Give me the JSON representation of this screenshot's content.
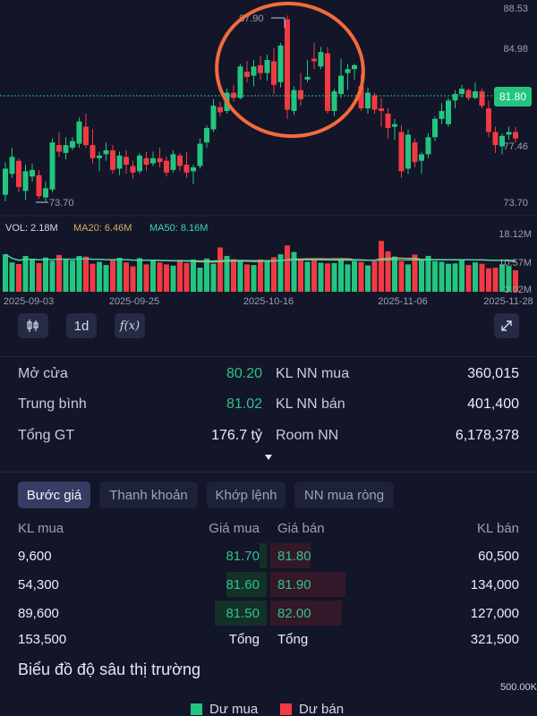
{
  "chart_data": {
    "type": "candlestick",
    "price_axis": {
      "ticks": [
        "88.53",
        "84.98",
        "77.46",
        "73.70"
      ],
      "current": "81.80",
      "high_label": "87.90",
      "low_label": "73.70"
    },
    "volume_axis": {
      "ticks": [
        "18.12M",
        "10.57M",
        "3.02M"
      ]
    },
    "x_labels": [
      "2025-09-03",
      "2025-09-25",
      "2025-10-16",
      "2025-11-06",
      "2025-11-28"
    ],
    "candles": [
      [
        74.2,
        76.7,
        73.7,
        76.2
      ],
      [
        75.8,
        77.8,
        75.5,
        77.1
      ],
      [
        76.8,
        77.0,
        74.4,
        74.8
      ],
      [
        74.5,
        76.5,
        73.8,
        76.0
      ],
      [
        75.6,
        76.6,
        75.2,
        76.1
      ],
      [
        75.7,
        76.1,
        73.9,
        74.1
      ],
      [
        74.0,
        75.2,
        73.7,
        74.7
      ],
      [
        74.6,
        78.5,
        74.4,
        78.2
      ],
      [
        78.0,
        79.0,
        77.1,
        77.5
      ],
      [
        77.4,
        78.6,
        76.9,
        78.0
      ],
      [
        77.8,
        78.6,
        77.6,
        78.3
      ],
      [
        78.1,
        80.1,
        77.8,
        79.8
      ],
      [
        79.4,
        80.4,
        77.8,
        78.0
      ],
      [
        78.0,
        79.2,
        76.6,
        77.0
      ],
      [
        77.0,
        77.5,
        76.0,
        77.2
      ],
      [
        77.3,
        78.2,
        76.8,
        77.6
      ],
      [
        77.6,
        78.0,
        75.8,
        76.1
      ],
      [
        76.2,
        77.5,
        75.7,
        77.2
      ],
      [
        77.1,
        77.6,
        75.8,
        76.5
      ],
      [
        76.4,
        76.8,
        75.4,
        75.9
      ],
      [
        76.0,
        77.4,
        75.8,
        77.2
      ],
      [
        77.0,
        77.5,
        76.0,
        76.5
      ],
      [
        76.6,
        77.5,
        76.4,
        77.0
      ],
      [
        77.0,
        77.8,
        76.3,
        76.7
      ],
      [
        76.8,
        77.1,
        75.6,
        75.9
      ],
      [
        76.1,
        77.6,
        75.9,
        77.3
      ],
      [
        77.2,
        77.4,
        76.0,
        76.4
      ],
      [
        76.5,
        77.5,
        75.5,
        75.9
      ],
      [
        76.0,
        76.5,
        75.0,
        76.3
      ],
      [
        76.4,
        78.5,
        76.2,
        78.1
      ],
      [
        78.2,
        79.5,
        77.8,
        79.3
      ],
      [
        79.2,
        81.5,
        79.0,
        81.0
      ],
      [
        80.9,
        81.3,
        80.2,
        80.5
      ],
      [
        80.6,
        82.3,
        80.4,
        82.0
      ],
      [
        82.0,
        82.6,
        81.3,
        81.6
      ],
      [
        81.6,
        84.2,
        81.5,
        84.0
      ],
      [
        83.6,
        84.4,
        82.8,
        83.2
      ],
      [
        83.3,
        84.5,
        82.5,
        84.0
      ],
      [
        84.1,
        84.8,
        83.0,
        83.5
      ],
      [
        83.5,
        84.9,
        82.9,
        84.5
      ],
      [
        84.4,
        85.4,
        81.9,
        82.6
      ],
      [
        82.8,
        85.8,
        82.4,
        85.6
      ],
      [
        87.6,
        87.9,
        80.0,
        80.7
      ],
      [
        80.6,
        82.5,
        80.3,
        82.2
      ],
      [
        82.2,
        83.5,
        81.0,
        81.5
      ],
      [
        83.0,
        84.5,
        82.8,
        83.2
      ],
      [
        84.6,
        85.8,
        83.8,
        84.4
      ],
      [
        84.0,
        85.5,
        83.8,
        85.1
      ],
      [
        85.0,
        85.5,
        80.4,
        80.6
      ],
      [
        80.6,
        82.3,
        80.2,
        82.1
      ],
      [
        81.9,
        84.6,
        81.6,
        83.3
      ],
      [
        83.5,
        84.2,
        82.2,
        83.8
      ],
      [
        83.8,
        84.2,
        83.0,
        84.1
      ],
      [
        82.5,
        83.4,
        80.6,
        80.8
      ],
      [
        80.8,
        82.4,
        80.4,
        82.0
      ],
      [
        81.8,
        82.0,
        80.4,
        80.7
      ],
      [
        80.8,
        81.6,
        79.4,
        80.6
      ],
      [
        80.4,
        80.8,
        78.5,
        79.3
      ],
      [
        79.4,
        80.0,
        78.4,
        79.6
      ],
      [
        79.0,
        79.5,
        75.5,
        76.0
      ],
      [
        76.2,
        79.2,
        75.8,
        78.8
      ],
      [
        78.2,
        78.5,
        76.3,
        76.7
      ],
      [
        76.8,
        77.5,
        75.8,
        77.3
      ],
      [
        77.3,
        78.9,
        77.0,
        78.6
      ],
      [
        78.6,
        80.2,
        78.3,
        80.0
      ],
      [
        80.0,
        81.2,
        79.6,
        80.6
      ],
      [
        79.6,
        81.6,
        79.4,
        81.4
      ],
      [
        81.4,
        82.2,
        80.8,
        81.9
      ],
      [
        81.9,
        82.6,
        81.6,
        82.3
      ],
      [
        82.2,
        82.3,
        81.4,
        81.6
      ],
      [
        81.6,
        82.8,
        81.5,
        82.1
      ],
      [
        82.1,
        82.3,
        80.8,
        81.0
      ],
      [
        80.8,
        81.4,
        78.6,
        79.0
      ],
      [
        79.0,
        79.4,
        77.4,
        78.0
      ],
      [
        77.9,
        78.9,
        77.3,
        78.7
      ],
      [
        78.8,
        79.4,
        78.4,
        79.0
      ],
      [
        79.0,
        79.4,
        78.2,
        78.5
      ]
    ],
    "volumes": [
      11.5,
      9.0,
      8.5,
      11.0,
      10.0,
      8.8,
      10.5,
      9.5,
      11.3,
      10.0,
      9.6,
      11.0,
      10.8,
      8.6,
      9.2,
      8.2,
      9.8,
      10.4,
      9.0,
      7.8,
      10.3,
      8.4,
      9.6,
      9.0,
      8.4,
      8.0,
      9.8,
      8.8,
      9.9,
      7.4,
      10.2,
      8.6,
      13.6,
      11.0,
      10.0,
      9.4,
      8.4,
      8.2,
      9.9,
      9.4,
      10.6,
      11.5,
      14.2,
      12.2,
      10.1,
      9.2,
      9.6,
      8.9,
      8.7,
      8.8,
      10.0,
      8.4,
      9.4,
      9.1,
      8.1,
      9.4,
      15.6,
      12.4,
      10.8,
      9.4,
      8.4,
      11.4,
      9.6,
      11.0,
      9.4,
      9.2,
      8.6,
      8.7,
      9.6,
      8.2,
      9.0,
      8.6,
      7.2,
      7.4,
      8.4,
      7.9,
      6.6
    ]
  },
  "chart": {
    "legend": {
      "vol": "VOL: 2.18M",
      "ma20": "MA20: 6.46M",
      "ma50": "MA50: 8.16M"
    },
    "colors": {
      "up": "#22c57f",
      "down": "#f13a44",
      "ma20": "#d4b15a",
      "ma50": "#3dd9b0",
      "annotation": "#f26b3a",
      "bg": "#131528"
    }
  },
  "toolbar": {
    "candle_icon": "candle-type-icon",
    "interval": "1d",
    "indicator": "f(x)",
    "expand_icon": "expand-icon"
  },
  "stats": {
    "open_label": "Mở cửa",
    "open_value": "80.20",
    "avg_label": "Trung bình",
    "avg_value": "81.02",
    "total_label": "Tổng GT",
    "total_value": "176.7 tỷ",
    "nn_buy_label": "KL NN mua",
    "nn_buy_value": "360,015",
    "nn_sell_label": "KL NN bán",
    "nn_sell_value": "401,400",
    "room_label": "Room NN",
    "room_value": "6,178,378"
  },
  "tabs": [
    "Bước giá",
    "Thanh khoản",
    "Khớp lệnh",
    "NN mua ròng"
  ],
  "orderbook": {
    "headers": {
      "bid_vol": "KL mua",
      "bid_price": "Giá mua",
      "ask_price": "Giá bán",
      "ask_vol": "KL bán"
    },
    "rows": [
      {
        "bid_vol": "9,600",
        "bid_price": "81.70",
        "ask_price": "81.80",
        "ask_vol": "60,500"
      },
      {
        "bid_vol": "54,300",
        "bid_price": "81.60",
        "ask_price": "81.90",
        "ask_vol": "134,000"
      },
      {
        "bid_vol": "89,600",
        "bid_price": "81.50",
        "ask_price": "82.00",
        "ask_vol": "127,000"
      }
    ],
    "total": {
      "bid_vol": "153,500",
      "bid_label": "Tổng",
      "ask_label": "Tổng",
      "ask_vol": "321,500"
    }
  },
  "depth": {
    "title": "Biểu đồ độ sâu thị trường",
    "max_label": "500.00K",
    "legend_buy": "Dư mua",
    "legend_sell": "Dư bán"
  }
}
